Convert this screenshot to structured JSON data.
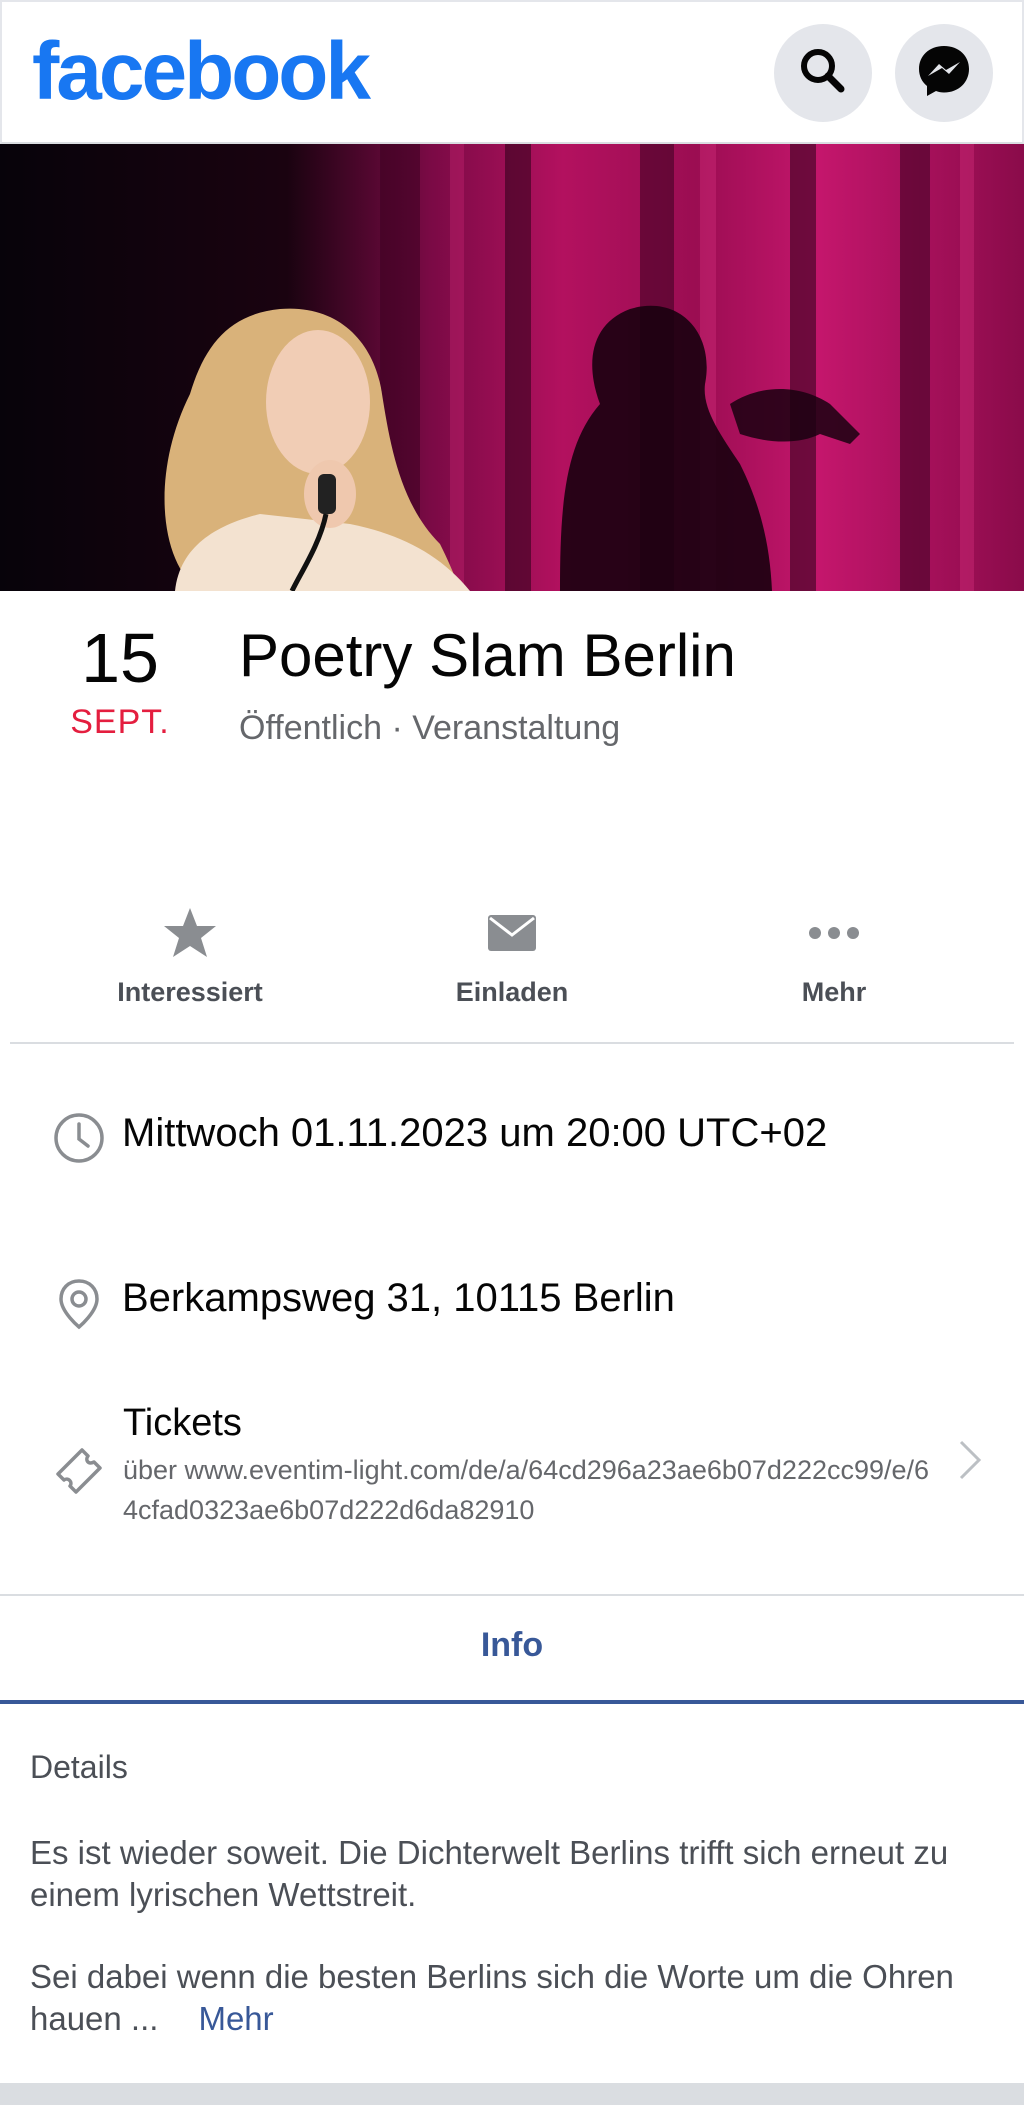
{
  "header": {
    "logo_text": "facebook",
    "search_icon": "search-icon",
    "messenger_icon": "messenger-icon",
    "brand_color": "#1877f2"
  },
  "cover": {
    "icon": "event-cover-photo"
  },
  "event": {
    "day": "15",
    "month": "SEPT.",
    "title": "Poetry Slam Berlin",
    "subtitle": "Öffentlich · Veranstaltung"
  },
  "actions": [
    {
      "label": "Interessiert",
      "icon": "star-icon"
    },
    {
      "label": "Einladen",
      "icon": "envelope-icon"
    },
    {
      "label": "Mehr",
      "icon": "more-dots-icon"
    }
  ],
  "info": {
    "time": "Mittwoch 01.11.2023 um 20:00 UTC+02",
    "location": "Berkampsweg 31, 10115 Berlin",
    "tickets_title": "Tickets",
    "tickets_url": "über www.eventim-light.com/de/a/64cd296a23ae6b07d222cc99/e/64cfad0323ae6b07d222d6da82910"
  },
  "tabs": {
    "info_label": "Info"
  },
  "details": {
    "title": "Details",
    "paragraph_1": "Es ist wieder soweit. Die Dichterwelt Berlins trifft sich erneut zu einem lyrischen Wettstreit.",
    "paragraph_2": "Sei dabei wenn die besten Berlins sich die Worte um die Ohren hauen ...",
    "more_label": "Mehr"
  }
}
